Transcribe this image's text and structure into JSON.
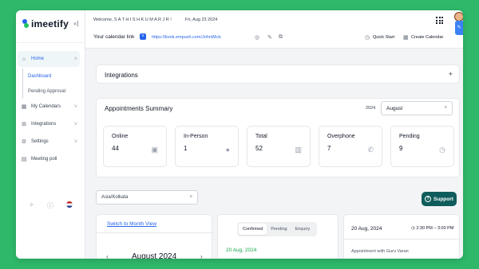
{
  "brand": {
    "name": "imeetify"
  },
  "header": {
    "welcome": "Welcome, S A T H I S H K U M A R J R !",
    "date": "Fri, Aug 23 2024",
    "calendar_link_label": "Your calendar link",
    "calendar_link": "https://book.empush.com/JohnWick",
    "quick_start": "Quick Start",
    "create_calendar": "Create Calendar"
  },
  "sidebar": {
    "home": "Home",
    "sub_items": [
      "Dashboard",
      "Pending Approval"
    ],
    "items": [
      "My Calendars",
      "Integrations",
      "Settings",
      "Meeting poll"
    ]
  },
  "integrations": {
    "title": "Integrations"
  },
  "summary": {
    "title": "Appointments Summary",
    "year": "2024",
    "month": "August",
    "stats": [
      {
        "label": "Online",
        "value": "44",
        "icon": "id-card-icon"
      },
      {
        "label": "In-Person",
        "value": "1",
        "icon": "person-icon"
      },
      {
        "label": "Total",
        "value": "52",
        "icon": "calculator-icon"
      },
      {
        "label": "Overphone",
        "value": "7",
        "icon": "phone-icon"
      },
      {
        "label": "Pending",
        "value": "9",
        "icon": "clock-icon"
      }
    ]
  },
  "timezone": "Asia/Kolkata",
  "support": {
    "label": "Support"
  },
  "calendar": {
    "switch_label": "Switch to Month View",
    "month_label": "August 2024"
  },
  "appointments": {
    "tabs": [
      "Confirmed",
      "Pending",
      "Enquiry"
    ],
    "active_tab": "Confirmed",
    "date": "20 Aug, 2024"
  },
  "detail": {
    "date": "20 Aug, 2024",
    "time": "2:30 PM – 3:00 PM",
    "title": "Appointment with Guru Varan"
  },
  "colors": {
    "accent": "#2563eb",
    "brand_green": "#2fb86a",
    "support": "#0f5c5c"
  }
}
